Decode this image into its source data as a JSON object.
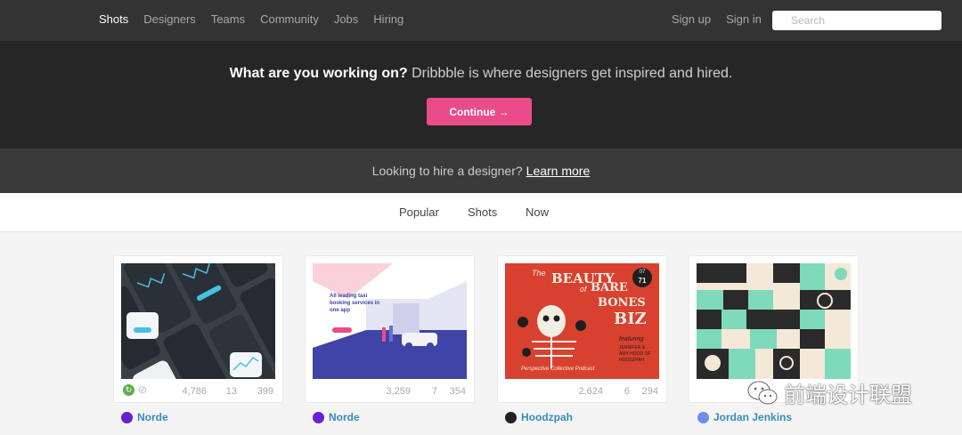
{
  "nav": {
    "left": [
      "Shots",
      "Designers",
      "Teams",
      "Community",
      "Jobs",
      "Hiring"
    ],
    "signup": "Sign up",
    "signin": "Sign in",
    "search_placeholder": "Search"
  },
  "hero": {
    "lead": "What are you working on?",
    "rest": " Dribbble is where designers get inspired and hired.",
    "cta": "Continue →"
  },
  "hire": {
    "text": "Looking to hire a designer?",
    "link": "Learn more"
  },
  "filters": [
    "Popular",
    "Shots",
    "Now"
  ],
  "shots": [
    {
      "views": "4,786",
      "comments": "13",
      "likes": "399",
      "author": "Norde",
      "avatar_color": "#6a1fd1"
    },
    {
      "views": "3,259",
      "comments": "7",
      "likes": "354",
      "author": "Norde",
      "avatar_color": "#6a1fd1",
      "art_text": "All leading taxi booking services in one app"
    },
    {
      "views": "2,624",
      "comments": "6",
      "likes": "294",
      "author": "Hoodzpah",
      "avatar_color": "#222222",
      "art_text": [
        "The",
        "BEAUTY",
        "of",
        "BARE",
        "BONES",
        "BIZ",
        "07",
        "71",
        "featuring",
        "JENNIFER &",
        "AMY HOOD OF",
        "HOODZPAH",
        "Perspective Collective Podcast"
      ]
    },
    {
      "views": "",
      "comments": "",
      "likes": "",
      "author": "Jordan Jenkins",
      "avatar_color": "#6b8ee8"
    }
  ],
  "watermark": "前端设计联盟",
  "colors": {
    "accent": "#ea4c89",
    "link": "#3a8bbb"
  }
}
